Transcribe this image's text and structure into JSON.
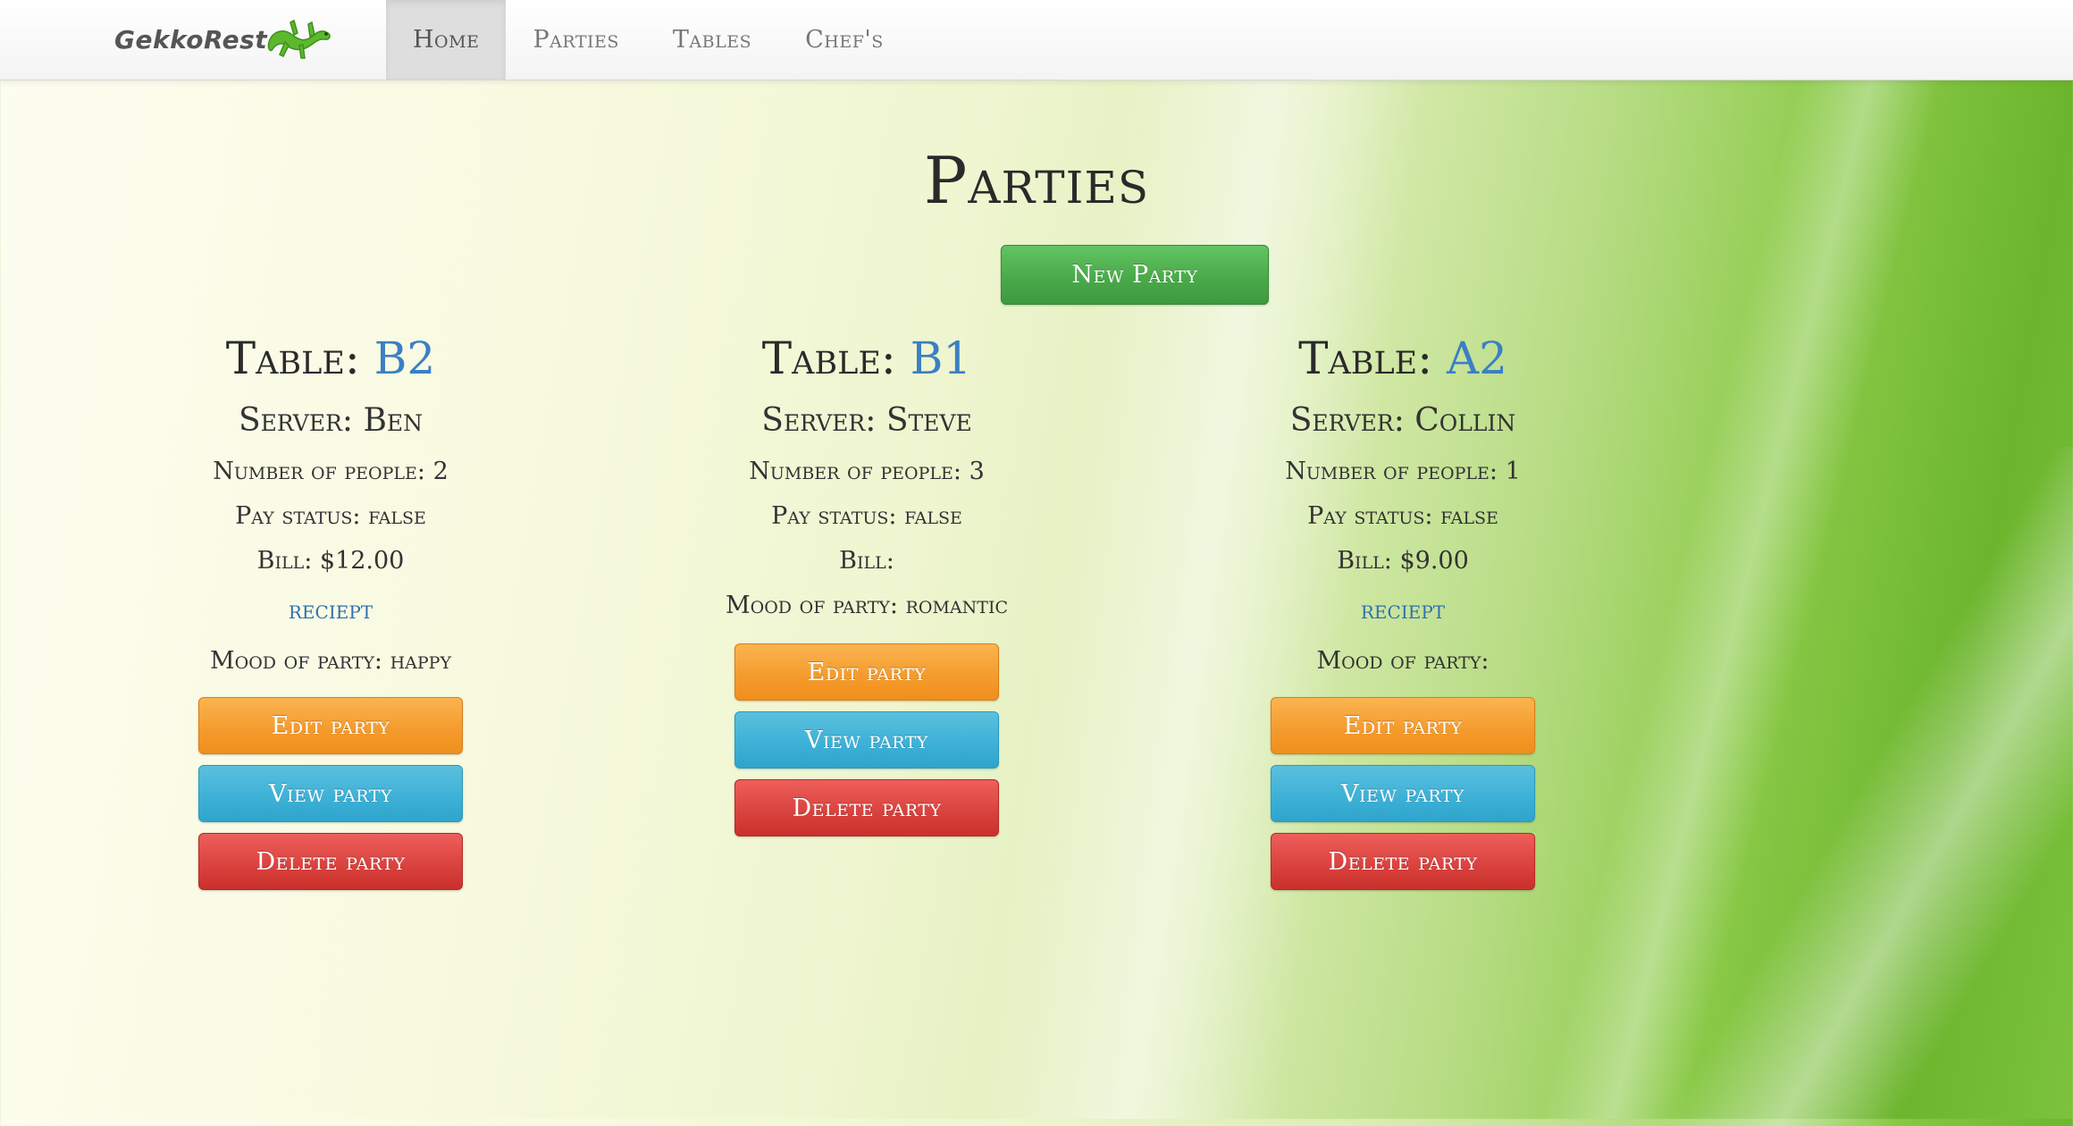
{
  "brand": {
    "name": "GekkoRest"
  },
  "nav": {
    "items": [
      {
        "label": "Home",
        "active": true
      },
      {
        "label": "Parties",
        "active": false
      },
      {
        "label": "Tables",
        "active": false
      },
      {
        "label": "Chef's",
        "active": false
      }
    ]
  },
  "page": {
    "title": "Parties",
    "new_party_label": "New Party"
  },
  "parties": [
    {
      "table_label": "Table: ",
      "table_code": "B2",
      "server": "Server: Ben",
      "people": "Number of people: 2",
      "pay_status": "Pay status: false",
      "bill": "Bill: $12.00",
      "receipt_label": "reciept",
      "mood": "Mood of party: happy",
      "edit_label": "Edit party",
      "view_label": "View party",
      "delete_label": "Delete party"
    },
    {
      "table_label": "Table: ",
      "table_code": "B1",
      "server": "Server: Steve",
      "people": "Number of people: 3",
      "pay_status": "Pay status: false",
      "bill": "Bill:",
      "mood": "Mood of party: romantic",
      "edit_label": "Edit party",
      "view_label": "View party",
      "delete_label": "Delete party"
    },
    {
      "table_label": "Table: ",
      "table_code": "A2",
      "server": "Server: Collin",
      "people": "Number of people: 1",
      "pay_status": "Pay status: false",
      "bill": "Bill: $9.00",
      "receipt_label": "reciept",
      "mood": "Mood of party:",
      "edit_label": "Edit party",
      "view_label": "View party",
      "delete_label": "Delete party"
    }
  ],
  "colors": {
    "link": "#3b7fc4",
    "success": "#48a848",
    "warning": "#f49a2c",
    "info": "#3cb0d6",
    "danger": "#d9413d"
  }
}
